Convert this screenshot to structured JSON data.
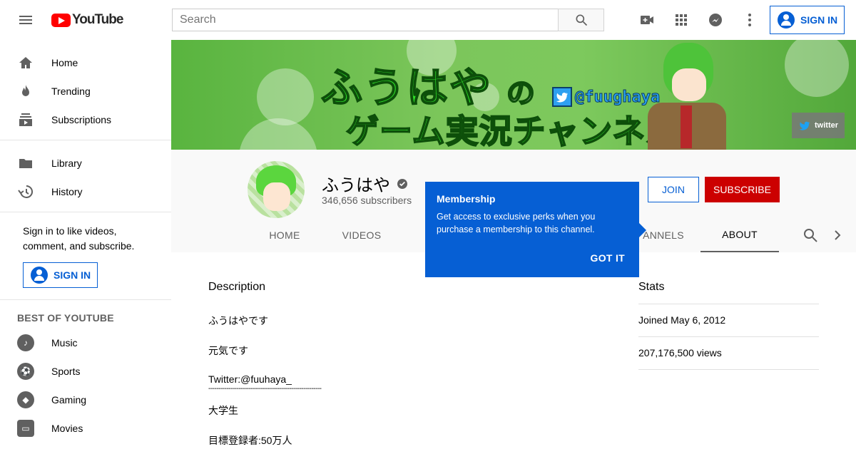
{
  "header": {
    "logo_text": "YouTube",
    "search_placeholder": "Search",
    "signin_label": "SIGN IN"
  },
  "sidebar": {
    "items": [
      {
        "label": "Home",
        "icon": "home-icon"
      },
      {
        "label": "Trending",
        "icon": "flame-icon"
      },
      {
        "label": "Subscriptions",
        "icon": "subscriptions-icon"
      },
      {
        "label": "Library",
        "icon": "folder-icon"
      },
      {
        "label": "History",
        "icon": "history-icon"
      }
    ],
    "signin_prompt": "Sign in to like videos, comment, and subscribe.",
    "signin_label": "SIGN IN",
    "best_of_title": "BEST OF YOUTUBE",
    "best_of": [
      {
        "label": "Music",
        "icon": "music-icon"
      },
      {
        "label": "Sports",
        "icon": "sports-icon"
      },
      {
        "label": "Gaming",
        "icon": "gaming-icon"
      },
      {
        "label": "Movies",
        "icon": "movies-icon"
      }
    ]
  },
  "banner": {
    "title": "ふうはや",
    "particle": "の",
    "subtitle": "ゲーム実況チャンネル",
    "handle": "@fuughaya",
    "link_label": "twitter"
  },
  "channel": {
    "name": "ふうはや",
    "subscribers": "346,656 subscribers",
    "join_label": "JOIN",
    "subscribe_label": "SUBSCRIBE",
    "tabs": [
      "HOME",
      "VIDEOS",
      "ANNELS",
      "ABOUT"
    ],
    "active_tab": "ABOUT"
  },
  "popup": {
    "title": "Membership",
    "body": "Get access to exclusive perks when you purchase a membership to this channel.",
    "button": "GOT IT"
  },
  "about": {
    "description_title": "Description",
    "description_lines": [
      "ふうはやです",
      "元気です",
      "Twitter:@fuuhaya_",
      "--------------------------------------------------------",
      "大学生",
      "目標登録者:50万人"
    ],
    "stats_title": "Stats",
    "joined": "Joined May 6, 2012",
    "views": "207,176,500 views"
  },
  "colors": {
    "brand_red": "#ff0000",
    "subscribe_red": "#cc0000",
    "accent_blue": "#065fd4",
    "banner_green": "#7cc65b"
  }
}
